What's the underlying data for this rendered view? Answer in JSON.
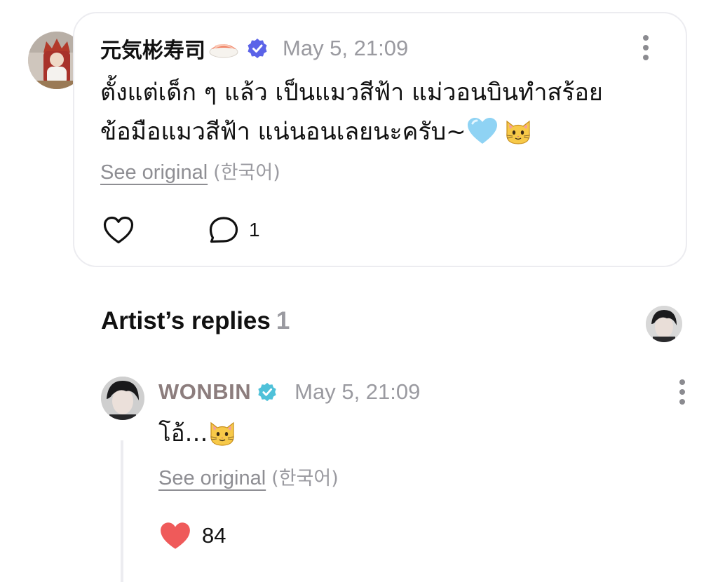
{
  "comment": {
    "author_name": "元気彬寿司",
    "author_emoji": "sushi-emoji",
    "verified_badge_color": "#5b63e8",
    "date": "May 5, 21:09",
    "body_line_1": "ตั้งแต่เด็ก ๆ แล้ว เป็นแมวสีฟ้า แม่วอนบินทำสร้อย",
    "body_line_2": "ข้อมือแมวสีฟ้า แน่นอนเลยนะครับ~",
    "body_emojis": [
      "light-blue-heart-emoji",
      "cat-face-emoji"
    ],
    "see_original_label": "See original",
    "original_language": "(한국어)",
    "comment_count": "1"
  },
  "artist_replies": {
    "title": "Artist’s replies",
    "count": "1"
  },
  "reply": {
    "author_name": "WONBIN",
    "verified_badge_color": "#4fc1d9",
    "date": "May 5, 21:09",
    "body": "โอ้…",
    "body_emoji": "cat-face-emoji",
    "see_original_label": "See original",
    "original_language": "(한국어)",
    "like_count": "84",
    "like_color": "#ef5a5a"
  }
}
